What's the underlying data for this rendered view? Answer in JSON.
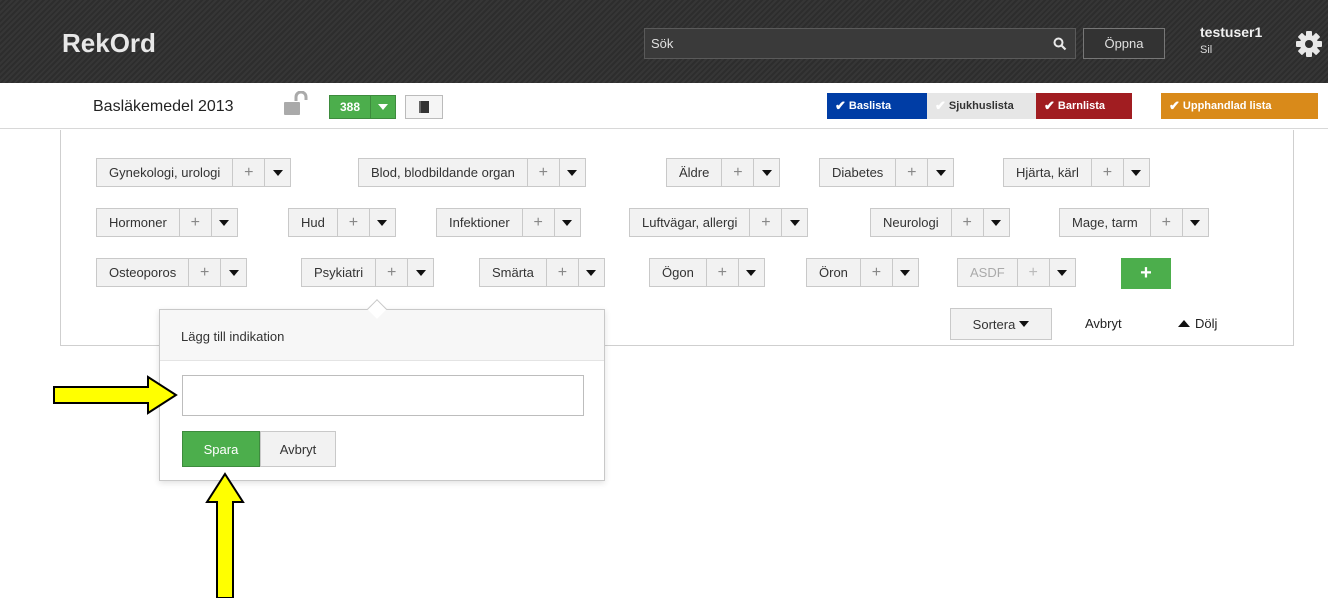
{
  "app": {
    "logo": "RekOrd"
  },
  "header": {
    "search_placeholder": "Sök",
    "open_label": "Öppna",
    "user_name": "testuser1",
    "user_sub": "Sil"
  },
  "subheader": {
    "list_title": "Basläkemedel 2013",
    "count": "388",
    "list_tabs": [
      {
        "label": "Baslista",
        "color": "#003da5",
        "text_color": "#ffffff",
        "check_color": "#ffffff"
      },
      {
        "label": "Sjukhuslista",
        "color": "#e6e6e6",
        "text_color": "#333333",
        "check_color": "#ffffff"
      },
      {
        "label": "Barnlista",
        "color": "#a11d21",
        "text_color": "#ffffff",
        "check_color": "#ffffff"
      },
      {
        "label": "Upphandlad lista",
        "color": "#d98a1a",
        "text_color": "#ffffff",
        "check_color": "#ffffff"
      }
    ]
  },
  "categories": {
    "row1": [
      "Gynekologi, urologi",
      "Blod, blodbildande organ",
      "Äldre",
      "Diabetes",
      "Hjärta, kärl"
    ],
    "row2": [
      "Hormoner",
      "Hud",
      "Infektioner",
      "Luftvägar, allergi",
      "Neurologi",
      "Mage, tarm"
    ],
    "row3": [
      "Osteoporos",
      "Psykiatri",
      "Smärta",
      "Ögon",
      "Öron",
      "ASDF"
    ],
    "plus_glyph": "+",
    "add_glyph": "+"
  },
  "actions": {
    "sort_label": "Sortera",
    "cancel_label": "Avbryt",
    "hide_label": "Dölj"
  },
  "popover": {
    "title": "Lägg till indikation",
    "input_value": "",
    "save_label": "Spara",
    "cancel_label": "Avbryt"
  },
  "colors": {
    "topbar": "#2f2f2f",
    "accent_green": "#4cae4c",
    "arrow_yellow": "#ffff00"
  }
}
